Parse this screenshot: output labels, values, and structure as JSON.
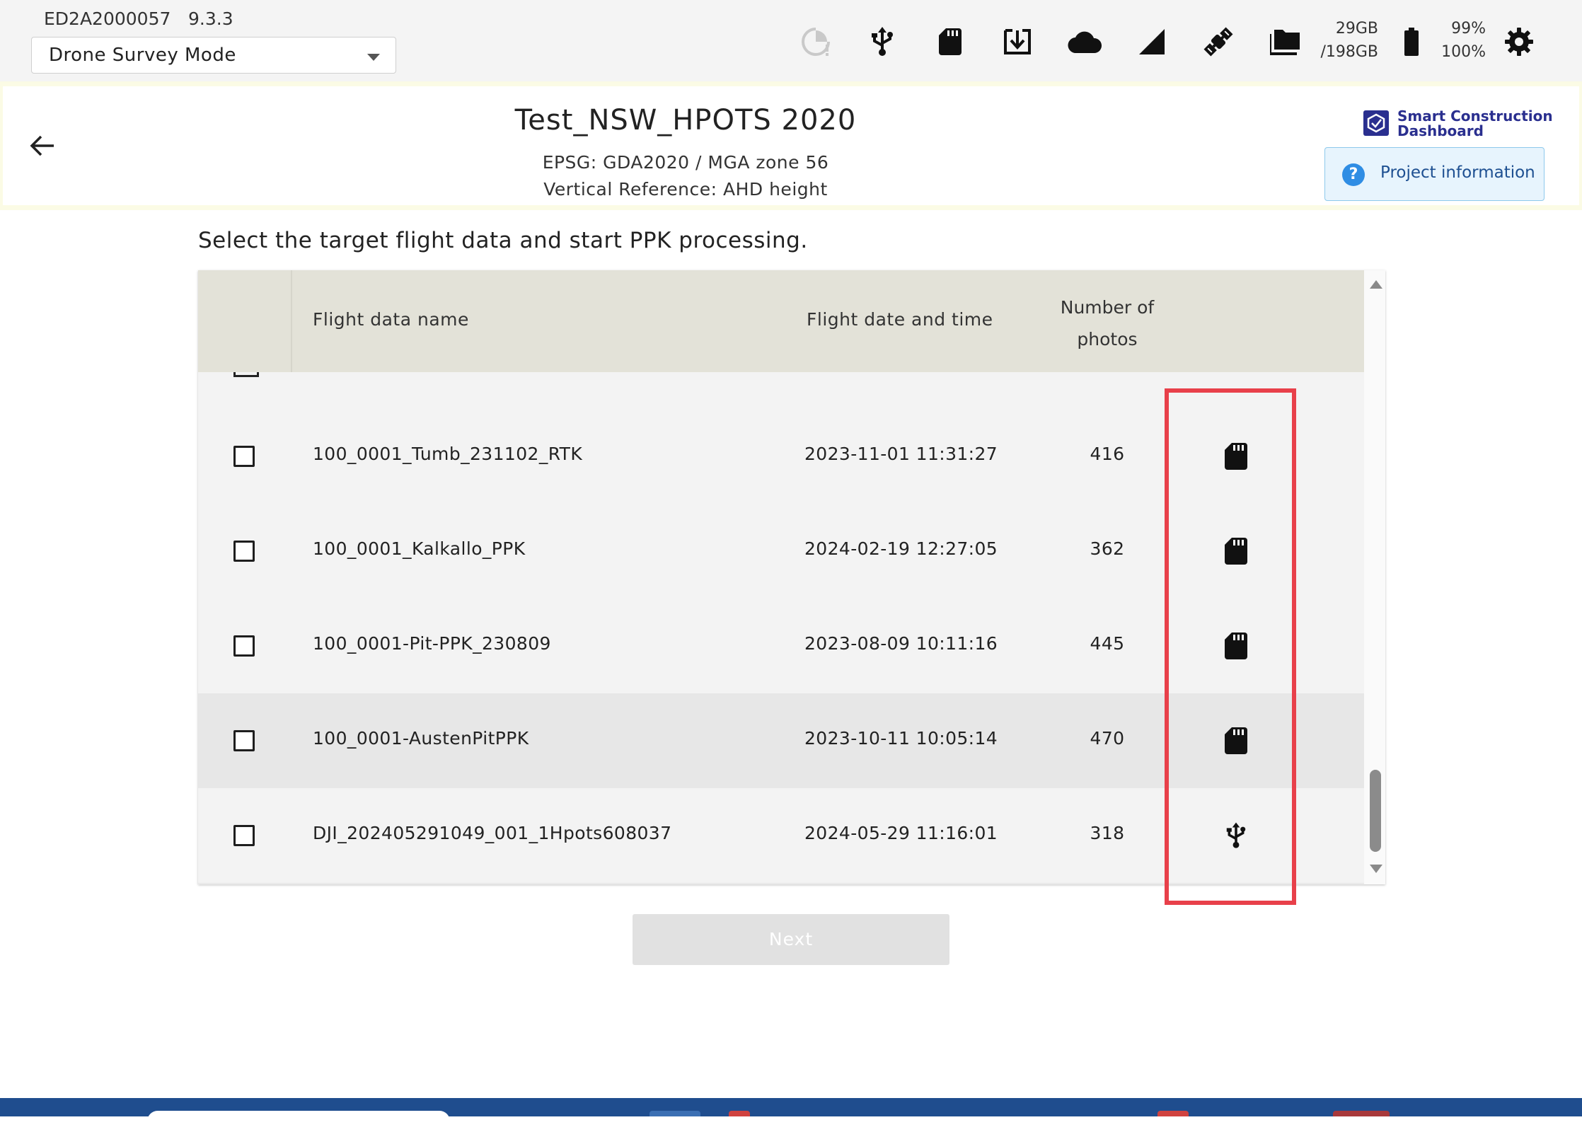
{
  "device": {
    "id": "ED2A2000057",
    "version": "9.3.3"
  },
  "mode_select": {
    "value": "Drone Survey Mode"
  },
  "status_icons": [
    "loading-alert-icon",
    "usb-icon",
    "sd-card-icon",
    "download-icon",
    "cloud-icon",
    "signal-icon",
    "satellite-icon",
    "folders-icon"
  ],
  "storage": {
    "used": "29GB",
    "total": "/198GB"
  },
  "battery": {
    "primary": "99%",
    "secondary": "100%"
  },
  "header": {
    "title": "Test_NSW_HPOTS 2020",
    "epsg": "EPSG: GDA2020 / MGA zone 56",
    "vertical_ref": "Vertical Reference: AHD height",
    "logo_line1": "Smart Construction",
    "logo_line2": "Dashboard",
    "project_info_label": "Project information"
  },
  "instruction": "Select the target flight data and start PPK processing.",
  "table": {
    "columns": {
      "name": "Flight data name",
      "date": "Flight date and time",
      "photos_line1": "Number of",
      "photos_line2": "photos"
    },
    "rows": [
      {
        "name": "100_0001_Tumb_231102_RTK",
        "date": "2023-11-01 11:31:27",
        "photos": "416",
        "source": "sd-card",
        "checked": false
      },
      {
        "name": "100_0001_Kalkallo_PPK",
        "date": "2024-02-19 12:27:05",
        "photos": "362",
        "source": "sd-card",
        "checked": false
      },
      {
        "name": "100_0001-Pit-PPK_230809",
        "date": "2023-08-09 10:11:16",
        "photos": "445",
        "source": "sd-card",
        "checked": false
      },
      {
        "name": "100_0001-AustenPitPPK",
        "date": "2023-10-11 10:05:14",
        "photos": "470",
        "source": "sd-card",
        "checked": false
      },
      {
        "name": "DJI_202405291049_001_1Hpots608037",
        "date": "2024-05-29 11:16:01",
        "photos": "318",
        "source": "usb",
        "checked": false
      }
    ]
  },
  "next_button": {
    "label": "Next",
    "enabled": false
  },
  "colors": {
    "highlight": "#e8404a",
    "header_bg": "#e3e2d8",
    "accent": "#2f8de4",
    "logo": "#2a2f8f",
    "taskbar": "#1f4d8e"
  }
}
